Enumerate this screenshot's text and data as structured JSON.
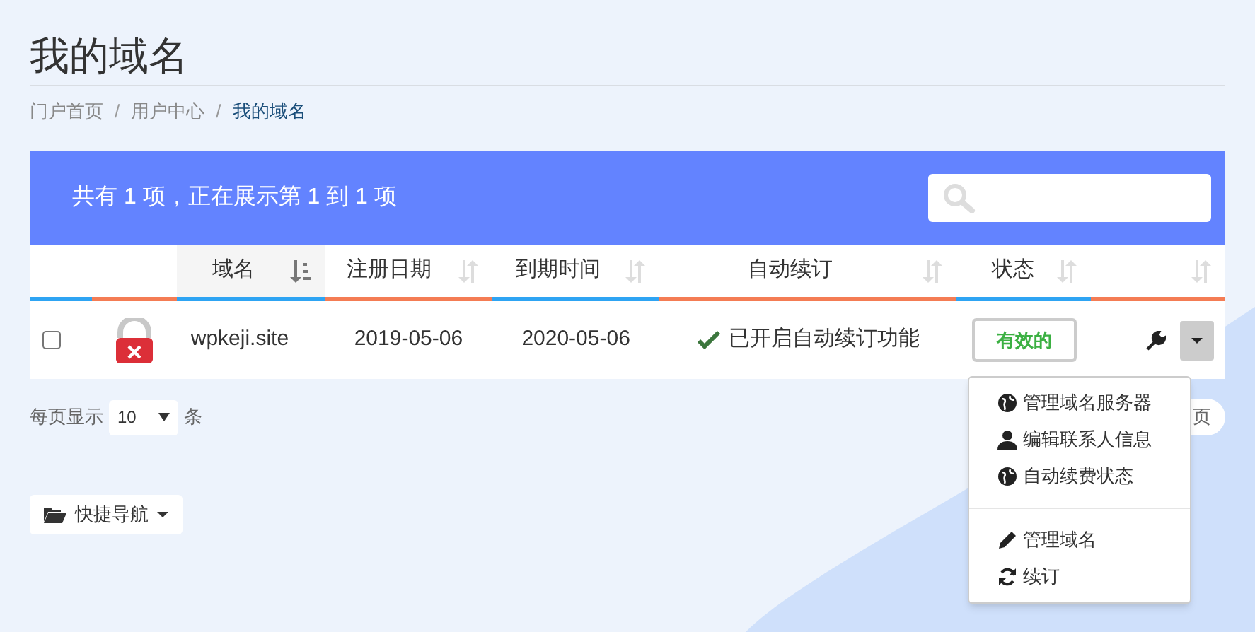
{
  "page_title": "我的域名",
  "breadcrumb": [
    {
      "label": "门户首页",
      "current": false
    },
    {
      "label": "用户中心",
      "current": false
    },
    {
      "label": "我的域名",
      "current": true
    }
  ],
  "breadcrumb_separator": "/",
  "table": {
    "summary": "共有 1 项，正在展示第 1 到 1 项",
    "columns": [
      {},
      {},
      {
        "label": "域名",
        "sortable": true,
        "sorted": true
      },
      {
        "label": "注册日期",
        "sortable": true,
        "sorted": false
      },
      {
        "label": "到期时间",
        "sortable": true,
        "sorted": false
      },
      {
        "label": "自动续订",
        "sortable": true,
        "sorted": false
      },
      {
        "label": "状态",
        "sortable": true,
        "sorted": false
      },
      {
        "sortable": true,
        "sorted": false
      }
    ],
    "rows": [
      {
        "checked": false,
        "locked": false,
        "domain": "wpkeji.site",
        "registered": "2019-05-06",
        "expires": "2020-05-06",
        "auto_renew": "已开启自动续订功能",
        "status": "有效的"
      }
    ]
  },
  "page_size": {
    "label": "每页显示",
    "value": "10",
    "suffix": "条"
  },
  "pagination": [
    {
      "label": "页"
    }
  ],
  "quick_nav": {
    "label": "快捷导航"
  },
  "dropdown_menu": [
    {
      "kind": "item",
      "label": "管理域名服务器"
    },
    {
      "kind": "item",
      "label": "编辑联系人信息"
    },
    {
      "kind": "item",
      "label": "自动续费状态"
    },
    {
      "kind": "divider"
    },
    {
      "kind": "item",
      "label": "管理域名"
    },
    {
      "kind": "item",
      "label": "续订"
    }
  ]
}
